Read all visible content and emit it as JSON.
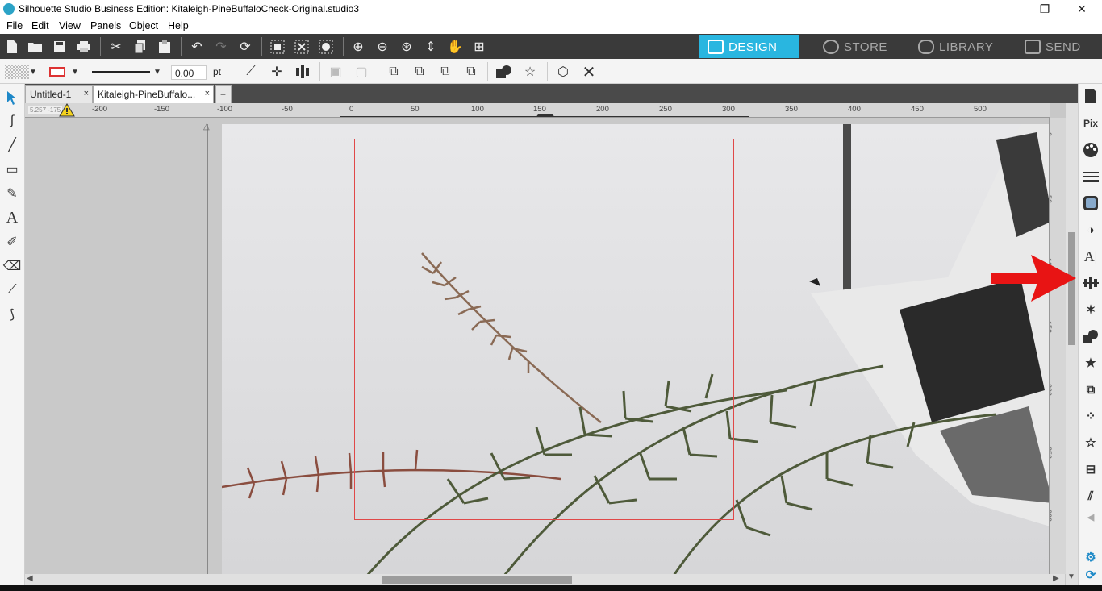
{
  "window": {
    "title": "Silhouette Studio Business Edition: Kitaleigh-PineBuffaloCheck-Original.studio3",
    "minimize": "—",
    "restore": "❐",
    "close": "✕"
  },
  "menu": [
    "File",
    "Edit",
    "View",
    "Panels",
    "Object",
    "Help"
  ],
  "nav_tabs": [
    {
      "label": "DESIGN",
      "active": true
    },
    {
      "label": "STORE",
      "active": false
    },
    {
      "label": "LIBRARY",
      "active": false
    },
    {
      "label": "SEND",
      "active": false
    }
  ],
  "line_width": {
    "value": "0.00",
    "unit": "pt"
  },
  "doc_tabs": [
    {
      "label": "Untitled-1",
      "close": "×"
    },
    {
      "label": "Kitaleigh-PineBuffalo...",
      "close": "×"
    }
  ],
  "add_tab": "+",
  "ruler": {
    "coord_readout": "5.257  -175",
    "h_ticks": [
      "-200",
      "-150",
      "-100",
      "-50",
      "0",
      "50",
      "100",
      "150",
      "200",
      "250",
      "300",
      "350",
      "400",
      "450",
      "500"
    ],
    "v_ticks": [
      "0",
      "50",
      "100",
      "150",
      "200",
      "250",
      "300"
    ]
  },
  "icons": {
    "app": "silhouette-logo-icon",
    "warning": "warning-icon",
    "highlight_arrow": "red-arrow-annotation"
  },
  "colors": {
    "accent": "#29b6e0",
    "cut_border": "#e04848",
    "toolbar_dark": "#3a3a3a",
    "annotation": "#e81414"
  }
}
